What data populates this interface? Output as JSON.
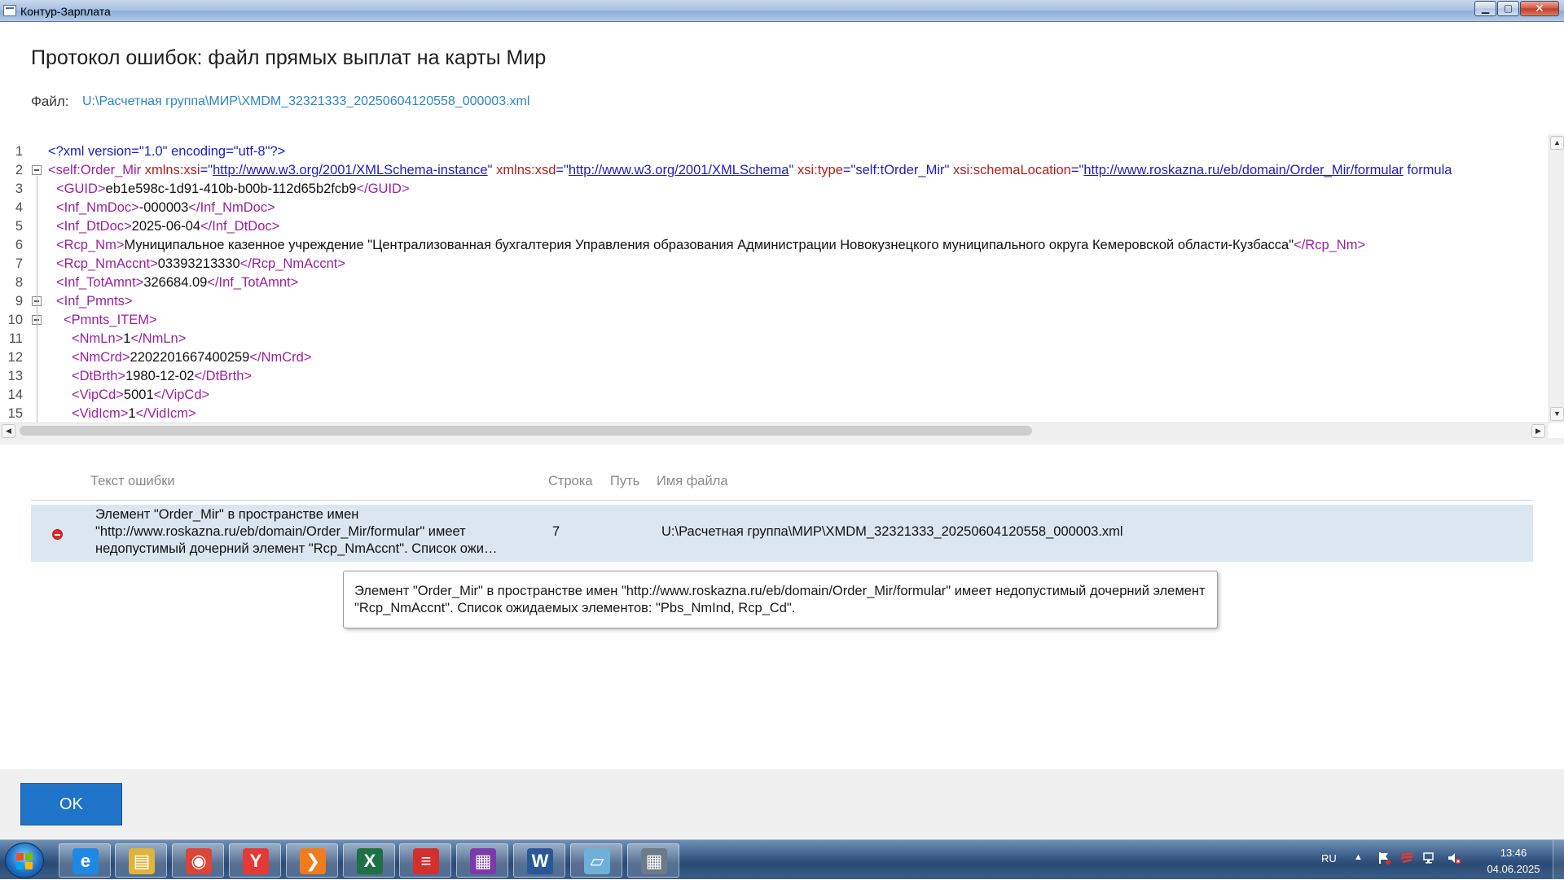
{
  "window": {
    "title": "Контур-Зарплата",
    "min": "▁",
    "max": "▢",
    "close": "✕"
  },
  "header": {
    "title": "Протокол ошибок: файл прямых выплат на карты Мир",
    "file_label": "Файл:",
    "file_path": "U:\\Расчетная группа\\МИР\\XMDM_32321333_20250604120558_000003.xml"
  },
  "xml_lines": [
    {
      "n": "1",
      "indent": 0,
      "fold": false,
      "parts": [
        [
          "pi",
          "<?xml version=\"1.0\" encoding=\"utf-8\"?>"
        ]
      ]
    },
    {
      "n": "2",
      "indent": 0,
      "fold": true,
      "parts": [
        [
          "tg",
          "<self:Order_Mir "
        ],
        [
          "at",
          "xmlns:"
        ],
        [
          "at",
          "xsi"
        ],
        [
          "eq",
          "=\""
        ],
        [
          "lk",
          "http://www.w3.org/2001/XMLSchema-instance"
        ],
        [
          "eq",
          "\" "
        ],
        [
          "at",
          "xmlns:"
        ],
        [
          "at",
          "xsd"
        ],
        [
          "eq",
          "=\""
        ],
        [
          "lk",
          "http://www.w3.org/2001/XMLSchema"
        ],
        [
          "eq",
          "\" "
        ],
        [
          "at",
          "xsi:type"
        ],
        [
          "eq",
          "=\""
        ],
        [
          "av",
          "self:tOrder_Mir"
        ],
        [
          "eq",
          "\" "
        ],
        [
          "at",
          "xsi:schemaLocation"
        ],
        [
          "eq",
          "=\""
        ],
        [
          "lk",
          "http://www.roskazna.ru/eb/domain/Order_Mir/formular"
        ],
        [
          "av",
          " formula"
        ]
      ]
    },
    {
      "n": "3",
      "indent": 1,
      "fold": false,
      "parts": [
        [
          "tg",
          "<GUID>"
        ],
        [
          "tx",
          "eb1e598c-1d91-410b-b00b-112d65b2fcb9"
        ],
        [
          "tg",
          "</GUID>"
        ]
      ]
    },
    {
      "n": "4",
      "indent": 1,
      "fold": false,
      "parts": [
        [
          "tg",
          "<Inf_NmDoc>"
        ],
        [
          "tx",
          "-000003"
        ],
        [
          "tg",
          "</Inf_NmDoc>"
        ]
      ]
    },
    {
      "n": "5",
      "indent": 1,
      "fold": false,
      "parts": [
        [
          "tg",
          "<Inf_DtDoc>"
        ],
        [
          "tx",
          "2025-06-04"
        ],
        [
          "tg",
          "</Inf_DtDoc>"
        ]
      ]
    },
    {
      "n": "6",
      "indent": 1,
      "fold": false,
      "parts": [
        [
          "tg",
          "<Rcp_Nm>"
        ],
        [
          "tx",
          "Муниципальное казенное учреждение \"Централизованная бухгалтерия Управления образования Администрации Новокузнецкого муниципального округа Кемеровской области-Кузбасса\""
        ],
        [
          "tg",
          "</Rcp_Nm>"
        ]
      ]
    },
    {
      "n": "7",
      "indent": 1,
      "fold": false,
      "parts": [
        [
          "tg",
          "<Rcp_NmAccnt>"
        ],
        [
          "tx",
          "03393213330"
        ],
        [
          "tg",
          "</Rcp_NmAccnt>"
        ]
      ]
    },
    {
      "n": "8",
      "indent": 1,
      "fold": false,
      "parts": [
        [
          "tg",
          "<Inf_TotAmnt>"
        ],
        [
          "tx",
          "326684.09"
        ],
        [
          "tg",
          "</Inf_TotAmnt>"
        ]
      ]
    },
    {
      "n": "9",
      "indent": 1,
      "fold": true,
      "parts": [
        [
          "tg",
          "<Inf_Pmnts>"
        ]
      ]
    },
    {
      "n": "10",
      "indent": 2,
      "fold": true,
      "parts": [
        [
          "tg",
          "<Pmnts_ITEM>"
        ]
      ]
    },
    {
      "n": "11",
      "indent": 3,
      "fold": false,
      "parts": [
        [
          "tg",
          "<NmLn>"
        ],
        [
          "tx",
          "1"
        ],
        [
          "tg",
          "</NmLn>"
        ]
      ]
    },
    {
      "n": "12",
      "indent": 3,
      "fold": false,
      "parts": [
        [
          "tg",
          "<NmCrd>"
        ],
        [
          "tx",
          "2202201667400259"
        ],
        [
          "tg",
          "</NmCrd>"
        ]
      ]
    },
    {
      "n": "13",
      "indent": 3,
      "fold": false,
      "parts": [
        [
          "tg",
          "<DtBrth>"
        ],
        [
          "tx",
          "1980-12-02"
        ],
        [
          "tg",
          "</DtBrth>"
        ]
      ]
    },
    {
      "n": "14",
      "indent": 3,
      "fold": false,
      "parts": [
        [
          "tg",
          "<VipCd>"
        ],
        [
          "tx",
          "5001"
        ],
        [
          "tg",
          "</VipCd>"
        ]
      ]
    },
    {
      "n": "15",
      "indent": 3,
      "fold": false,
      "parts": [
        [
          "tg",
          "<VidIcm>"
        ],
        [
          "tx",
          "1"
        ],
        [
          "tg",
          "</VidIcm>"
        ]
      ]
    }
  ],
  "scroll": {
    "up": "▲",
    "down": "▼",
    "left": "◀",
    "right": "▶"
  },
  "errors_table": {
    "columns": [
      "Текст ошибки",
      "Строка",
      "Путь",
      "Имя файла"
    ],
    "rows": [
      {
        "text": "Элемент \"Order_Mir\" в пространстве имен \"http://www.roskazna.ru/eb/domain/Order_Mir/formular\" имеет недопустимый дочерний элемент \"Rcp_NmAccnt\". Список ожи…",
        "line": "7",
        "path": "",
        "file": "U:\\Расчетная группа\\МИР\\XMDM_32321333_20250604120558_000003.xml"
      }
    ]
  },
  "tooltip": "Элемент \"Order_Mir\" в пространстве имен \"http://www.roskazna.ru/eb/domain/Order_Mir/formular\" имеет недопустимый дочерний элемент \"Rcp_NmAccnt\". Список ожидаемых элементов: \"Pbs_NmInd, Rcp_Cd\".",
  "footer": {
    "ok_label": "OK"
  },
  "taskbar": {
    "apps": [
      {
        "name": "ie-icon",
        "glyph": "e",
        "color": "#1e88e5"
      },
      {
        "name": "explorer-folder-icon",
        "glyph": "▤",
        "color": "#e0b43c"
      },
      {
        "name": "chrome-icon",
        "glyph": "◉",
        "color": "#db4437"
      },
      {
        "name": "yandex-browser-icon",
        "glyph": "Y",
        "color": "#e53935"
      },
      {
        "name": "kontur-icon",
        "glyph": "❯",
        "color": "#f07c1e"
      },
      {
        "name": "excel-icon",
        "glyph": "X",
        "color": "#1e7145"
      },
      {
        "name": "kontur-red-icon",
        "glyph": "≡",
        "color": "#d32f2f"
      },
      {
        "name": "winrar-icon",
        "glyph": "▦",
        "color": "#7b3aa8"
      },
      {
        "name": "word-icon",
        "glyph": "W",
        "color": "#2b579a"
      },
      {
        "name": "notepad-icon",
        "glyph": "▱",
        "color": "#6fb0d8"
      },
      {
        "name": "calculator-icon",
        "glyph": "▦",
        "color": "#6c7a89"
      }
    ],
    "tray": {
      "lang": "RU",
      "arrow": "▲",
      "time": "13:46",
      "date": "04.06.2025"
    }
  }
}
